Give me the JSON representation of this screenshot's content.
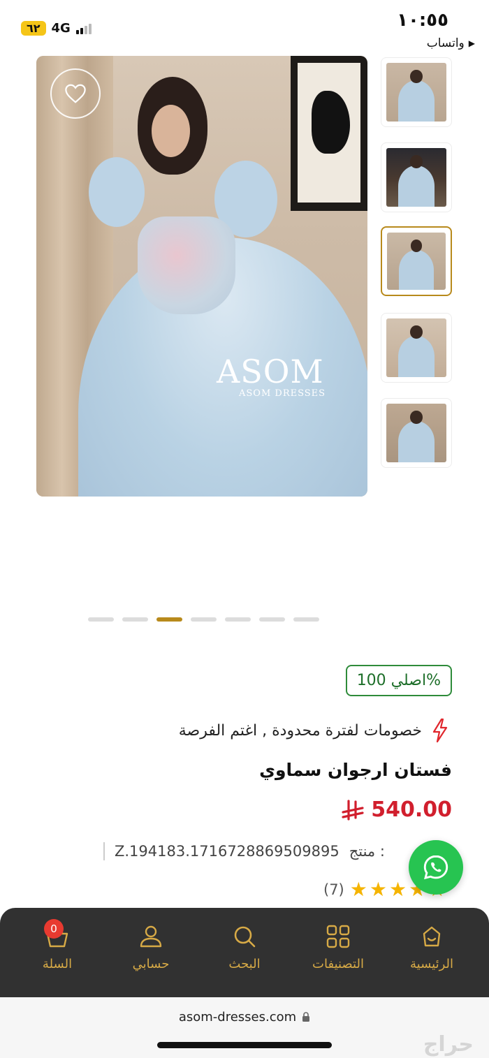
{
  "status_bar": {
    "time": "١٠:٥٥",
    "back_app": "واتساب",
    "battery": "٦٢",
    "network": "4G"
  },
  "product": {
    "watermark_brand": "ASOM",
    "watermark_sub": "ASOM DRESSES",
    "badge": "اصلي 100%",
    "promo_text": "خصومات لفترة محدودة , اغتم الفرصة",
    "title": "فستان ارجوان سماوي",
    "price": "540.00",
    "currency_symbol": "ر.س",
    "sku_label": "منتج :",
    "sku_value": "Z.194183.1716728869509895",
    "rating_count": "(7)",
    "rating_value": 5,
    "thumbnails_count": 5,
    "active_thumbnail": 3,
    "pages_count": 7,
    "active_page": 3
  },
  "nav": {
    "home": "الرئيسية",
    "categories": "التصنيفات",
    "search": "البحث",
    "account": "حسابي",
    "cart": "السلة",
    "cart_count": "0"
  },
  "browser": {
    "url": "asom-dresses.com",
    "watermark": "حراج"
  },
  "colors": {
    "accent_gold": "#b88a1c",
    "nav_bg": "#313131",
    "price_red": "#d11f2d",
    "badge_green": "#2e8b3a",
    "whatsapp_green": "#27c451",
    "star_yellow": "#f5b400"
  }
}
